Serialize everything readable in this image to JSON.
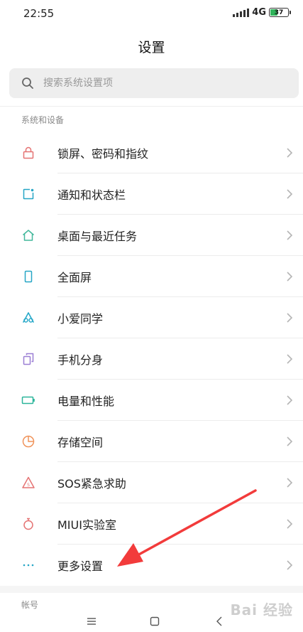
{
  "status_bar": {
    "time": "22:55",
    "network": "4G",
    "battery": "37"
  },
  "header": {
    "title": "设置"
  },
  "search": {
    "placeholder": "搜索系统设置项"
  },
  "section": {
    "label": "系统和设备"
  },
  "items": [
    {
      "label": "锁屏、密码和指纹",
      "icon": "lock-icon",
      "color": "#e57373"
    },
    {
      "label": "通知和状态栏",
      "icon": "notification-icon",
      "color": "#26a6c6"
    },
    {
      "label": "桌面与最近任务",
      "icon": "home-icon",
      "color": "#43b89c"
    },
    {
      "label": "全面屏",
      "icon": "fullscreen-icon",
      "color": "#26a6c6"
    },
    {
      "label": "小爱同学",
      "icon": "xiaoai-icon",
      "color": "#2aa9c9"
    },
    {
      "label": "手机分身",
      "icon": "second-space-icon",
      "color": "#9b7fd4"
    },
    {
      "label": "电量和性能",
      "icon": "battery-icon",
      "color": "#2bb59a"
    },
    {
      "label": "存储空间",
      "icon": "storage-icon",
      "color": "#f0935a"
    },
    {
      "label": "SOS紧急求助",
      "icon": "sos-icon",
      "color": "#e57373"
    },
    {
      "label": "MIUI实验室",
      "icon": "lab-icon",
      "color": "#e57373"
    },
    {
      "label": "更多设置",
      "icon": "more-dots-icon",
      "color": "#26a6c6"
    }
  ],
  "next_section": {
    "label": "帐号"
  },
  "watermark": {
    "text": "Bai 经验"
  },
  "annotation": {
    "color": "#f23b3b"
  }
}
